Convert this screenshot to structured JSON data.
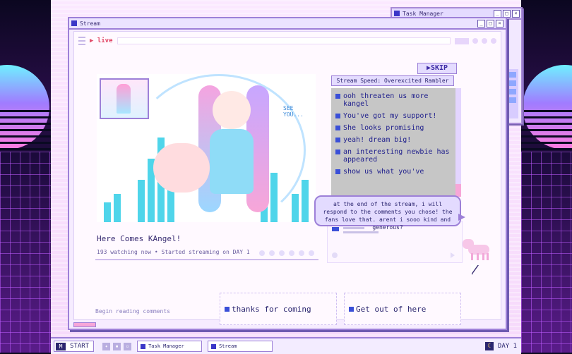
{
  "task_manager": {
    "title": "Task Manager"
  },
  "stream_window": {
    "title": "Stream",
    "live_label": "live",
    "skip_label": "SKIP",
    "see_you_text": "SEE YOU...",
    "stream_title": "Here Comes KAngel!",
    "meta": "193 watching now • Started streaming on DAY 1",
    "speed_label": "Stream Speed: Overexcited Rambler",
    "comments": [
      "ooh threaten us more kangel",
      "You've got my support!",
      "She looks promising",
      "yeah! dream big!",
      "an interesting newbie has appeared",
      "show us what you've"
    ],
    "bubble_text": "at the end of the stream, i will respond to the comments you chose! the fans love that. arent i sooo kind and generous?",
    "begin_reading": "Begin reading comments",
    "options": [
      "thanks for coming",
      "Get out of here"
    ]
  },
  "taskbar": {
    "start_label": "START",
    "tasks": [
      "Task Manager",
      "Stream"
    ],
    "day_label": "DAY 1"
  },
  "colors": {
    "accent": "#3b37c8",
    "border": "#9d80d8",
    "pink": "#f7a6d8",
    "cyan": "#4fd5ea"
  }
}
